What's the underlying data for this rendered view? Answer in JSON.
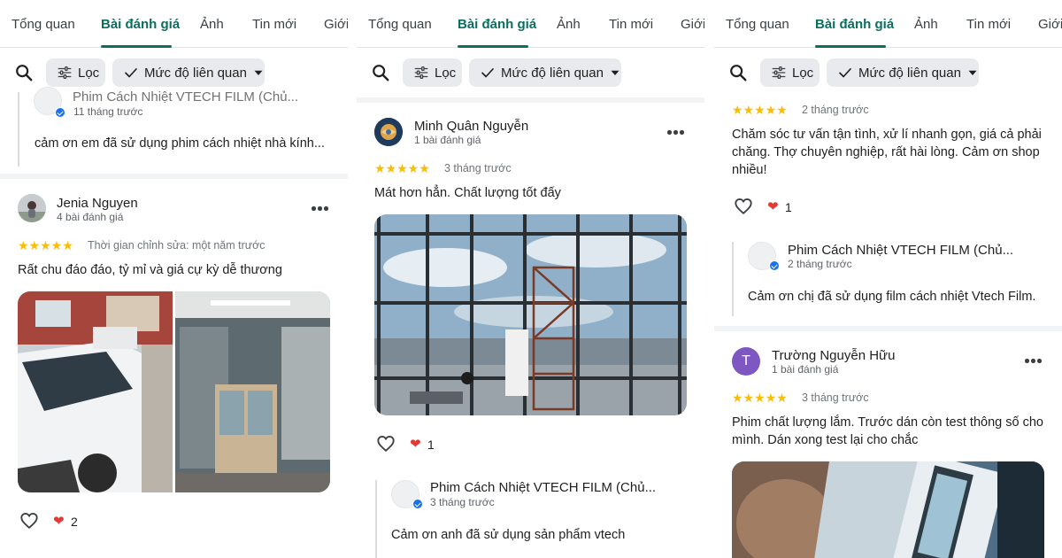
{
  "tabs": [
    "Tổng quan",
    "Bài đánh giá",
    "Ảnh",
    "Tin mới",
    "Giới"
  ],
  "toolbar": {
    "filter_label": "Lọc",
    "sort_label": "Mức độ liên quan"
  },
  "colors": {
    "accent": "#0b6e5f",
    "star": "#fbbc04",
    "heart_red": "#e53935",
    "verified": "#1a73e8"
  },
  "panel1": {
    "owner_reply_top": {
      "name": "Phim Cách Nhiệt VTECH FILM (Chủ...",
      "time": "11 tháng trước",
      "text": "cảm ơn em đã sử dụng phim cách nhiệt nhà kính..."
    },
    "review": {
      "name": "Jenia Nguyen",
      "meta": "4 bài đánh giá",
      "stars": "★★★★★",
      "time": "Thời gian chỉnh sửa: một năm trước",
      "text": "Rất chu đáo đáo, tỷ mỉ và giá  cự kỳ dễ thương",
      "like_count": "2"
    }
  },
  "panel2": {
    "review": {
      "name": "Minh Quân Nguyễn",
      "meta": "1 bài đánh giá",
      "stars": "★★★★★",
      "time": "3 tháng trước",
      "text": "Mát hơn hẳn. Chất lượng tốt đấy",
      "like_count": "1"
    },
    "owner_reply": {
      "name": "Phim Cách Nhiệt VTECH FILM (Chủ...",
      "time": "3 tháng trước",
      "text": "Cảm ơn anh đã sử dụng sản phẩm vtech"
    }
  },
  "panel3": {
    "review_top": {
      "stars": "★★★★★",
      "time": "2 tháng trước",
      "text": "Chăm sóc tư vấn tận tình, xử lí nhanh gọn, giá cả phải chăng. Thợ chuyên nghiệp, rất hài lòng. Cảm ơn shop nhiều!",
      "like_count": "1"
    },
    "owner_reply": {
      "name": "Phim Cách Nhiệt VTECH FILM (Chủ...",
      "time": "2 tháng trước",
      "text": "Cảm ơn chị đã sử dụng film cách nhiệt Vtech Film."
    },
    "review": {
      "initial": "T",
      "name": "Trường Nguyễn Hữu",
      "meta": "1 bài đánh giá",
      "stars": "★★★★★",
      "time": "3 tháng trước",
      "text": "Phim chất lượng lắm. Trước dán còn test thông số cho mình. Dán xong test lại cho chắc"
    }
  }
}
